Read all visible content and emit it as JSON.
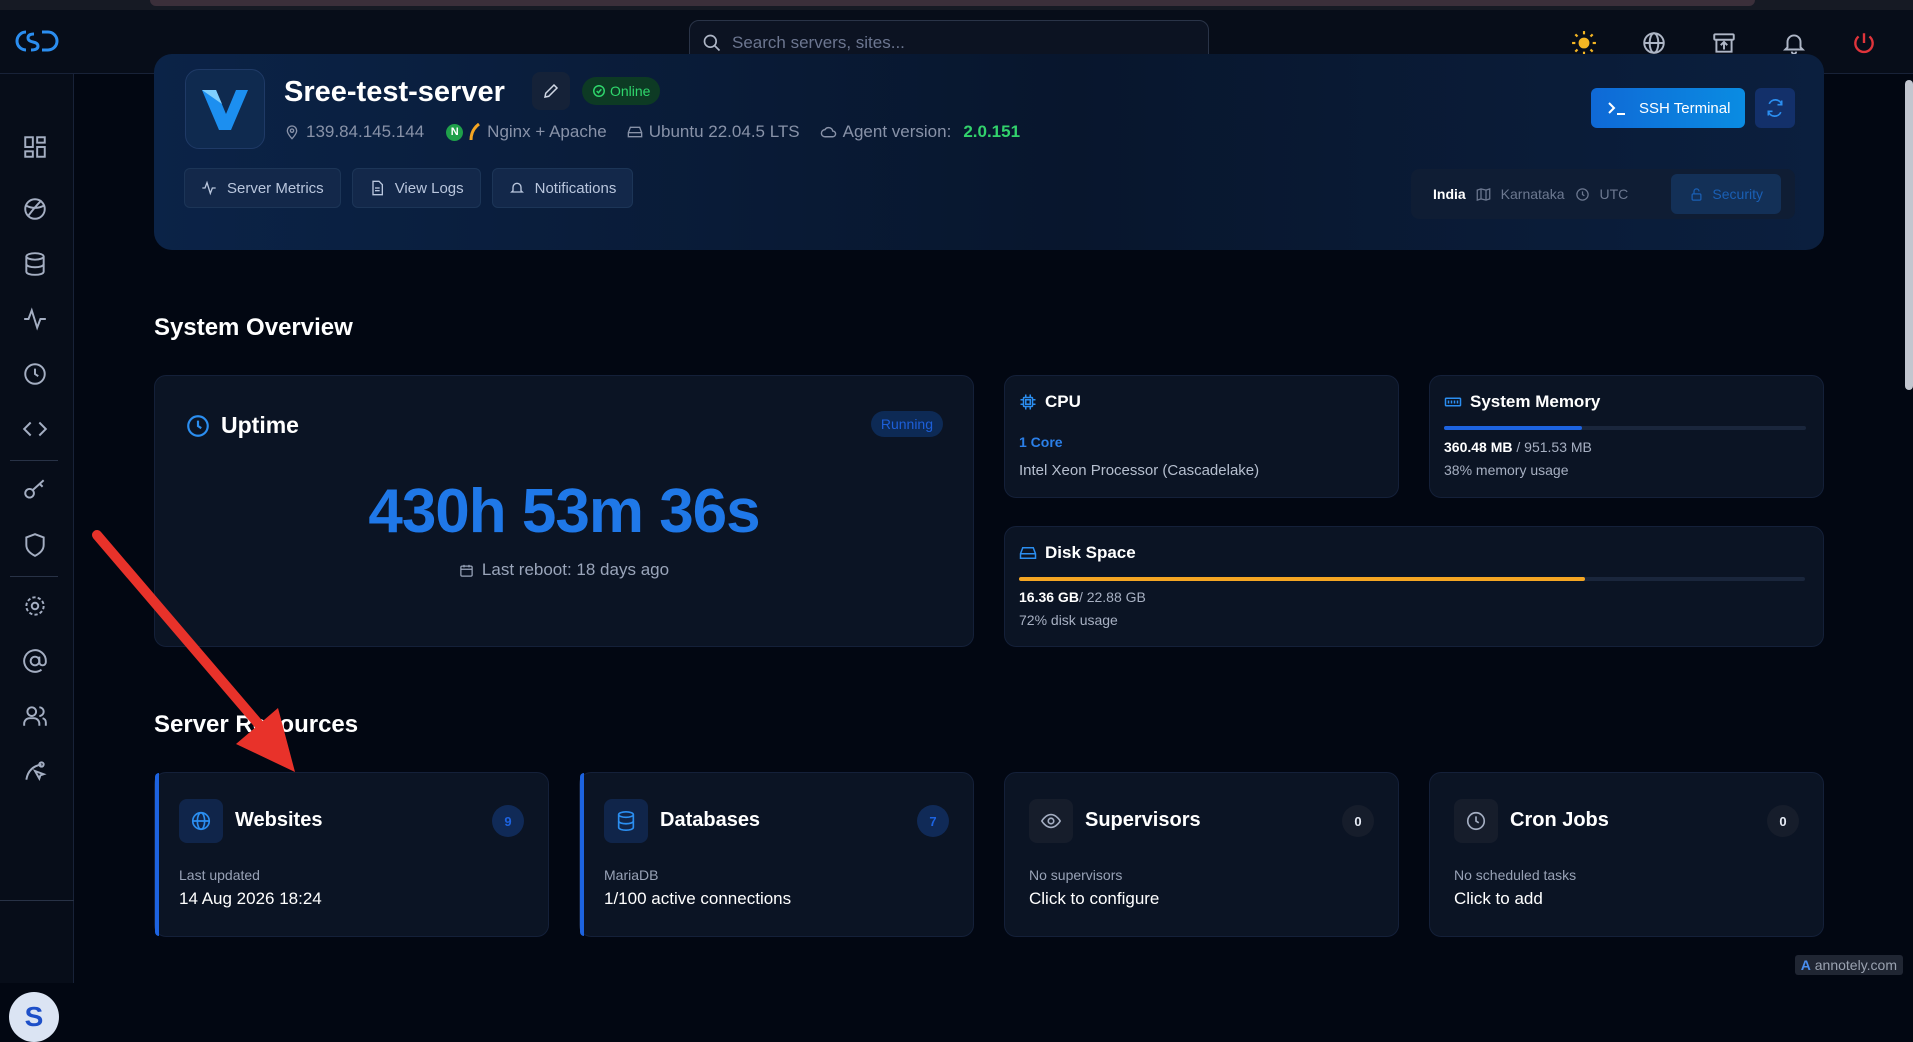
{
  "search": {
    "placeholder": "Search servers, sites..."
  },
  "server": {
    "name": "Sree-test-server",
    "status": "Online",
    "ip": "139.84.145.144",
    "stack": "Nginx + Apache",
    "os": "Ubuntu 22.04.5 LTS",
    "agent_label": "Agent version:",
    "agent_version": "2.0.151"
  },
  "hero_buttons": {
    "metrics": "Server Metrics",
    "logs": "View Logs",
    "notifications": "Notifications"
  },
  "ssh_label": "SSH Terminal",
  "location": {
    "country": "India",
    "region": "Karnataka",
    "timezone": "UTC",
    "security": "Security"
  },
  "overview": {
    "title": "System Overview",
    "uptime": {
      "title": "Uptime",
      "badge": "Running",
      "value": "430h 53m 36s",
      "reboot": "Last reboot: 18 days ago"
    },
    "cpu": {
      "title": "CPU",
      "cores": "1 Core",
      "model": "Intel Xeon Processor (Cascadelake)"
    },
    "memory": {
      "title": "System Memory",
      "used": "360.48 MB",
      "total": " / 951.53 MB",
      "usage": "38% memory usage",
      "percent": 38
    },
    "disk": {
      "title": "Disk Space",
      "used": "16.36 GB",
      "total": "/ 22.88 GB",
      "usage": "72% disk usage",
      "percent": 72
    }
  },
  "resources": {
    "title": "Server Resources",
    "websites": {
      "title": "Websites",
      "count": "9",
      "sub": "Last updated",
      "value": "14 Aug 2026 18:24"
    },
    "databases": {
      "title": "Databases",
      "count": "7",
      "sub": "MariaDB",
      "value": "1/100 active connections"
    },
    "supervisors": {
      "title": "Supervisors",
      "count": "0",
      "sub": "No supervisors",
      "value": "Click to configure"
    },
    "cron": {
      "title": "Cron Jobs",
      "count": "0",
      "sub": "No scheduled tasks",
      "value": "Click to add"
    }
  },
  "user": {
    "initial": "S"
  },
  "watermark": "annotely.com",
  "colors": {
    "accent": "#1f78e8",
    "online": "#2fd66c",
    "disk": "#f5a623",
    "memory": "#1d63e0",
    "danger": "#e0343b"
  }
}
